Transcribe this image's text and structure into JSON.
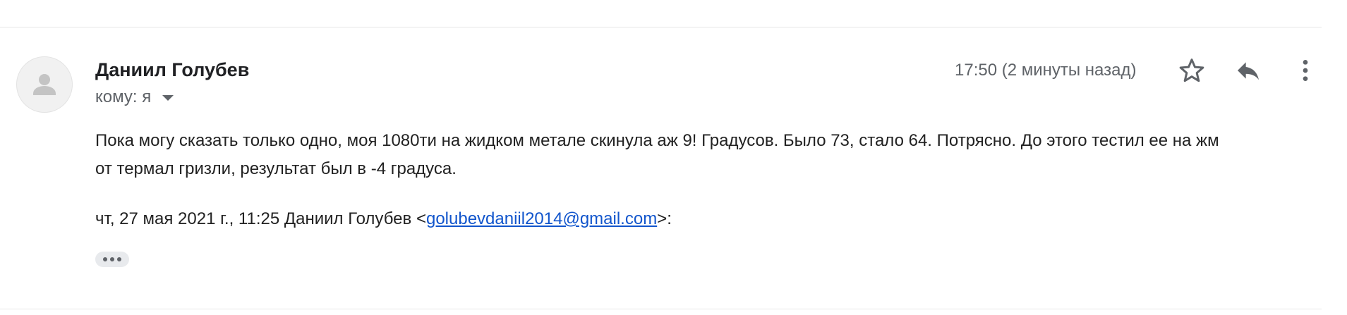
{
  "message": {
    "sender_name": "Даниил Голубев",
    "recipient_label": "кому: я",
    "timestamp": "17:50 (2 минуты назад)",
    "body_lines": [
      "Пока могу сказать только одно, моя 1080ти на жидком метале скинула аж 9! Градусов. Было 73, стало 64. Потрясно. До этого тестил ее на жм",
      "от термал гризли, результат был в -4 градуса."
    ],
    "quote_header": {
      "prefix": "чт, 27 мая 2021 г., 11:25 Даниил Голубев <",
      "email": "golubevdaniil2014@gmail.com",
      "suffix": ">:"
    }
  },
  "icons": {
    "avatar": "person-icon",
    "recipient_dropdown": "chevron-down-icon",
    "star": "star-icon",
    "reply": "reply-icon",
    "more": "more-vert-icon",
    "show_trimmed": "ellipsis-icon"
  },
  "colors": {
    "link": "#1155cc",
    "secondary_text": "#5f6368",
    "primary_text": "#202124",
    "avatar_bg": "#f1f1f1",
    "divider": "#e6e6e6"
  }
}
